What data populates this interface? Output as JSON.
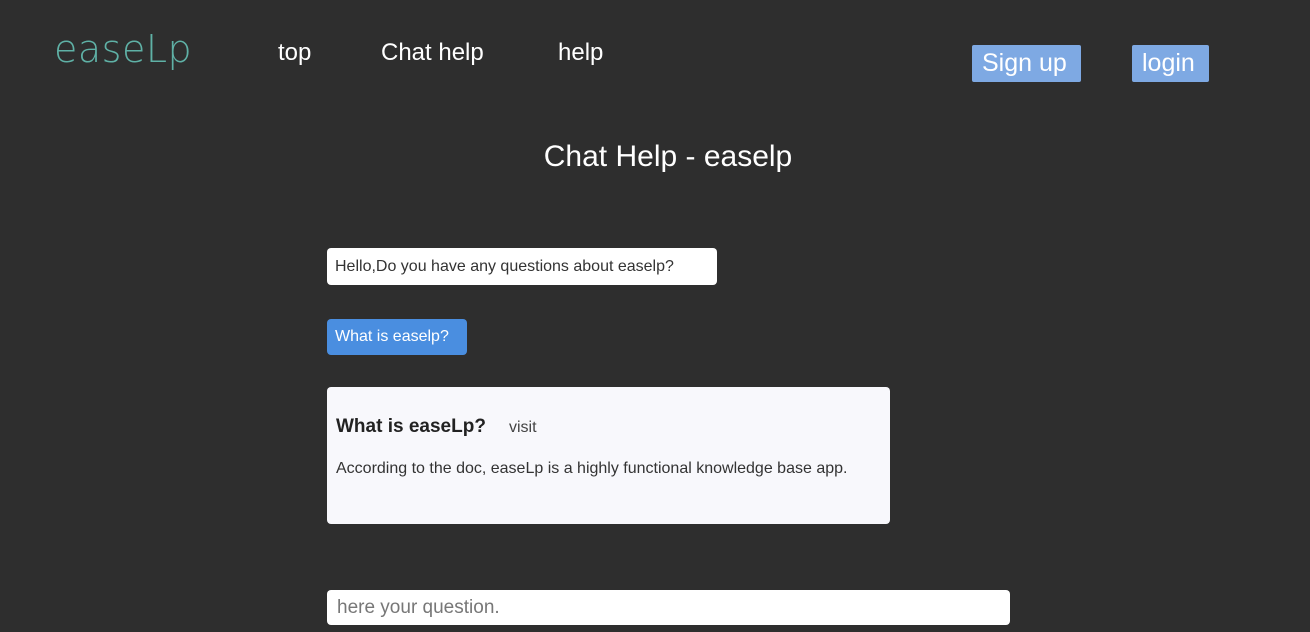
{
  "header": {
    "logo": "easeLp",
    "nav": {
      "top": "top",
      "chat_help": "Chat help",
      "help": "help"
    },
    "signup_label": "Sign up",
    "login_label": "login"
  },
  "page_title": "Chat Help - easelp",
  "chat": {
    "bot_greeting": "Hello,Do you have any questions about easelp?",
    "user_question": "What is easelp?",
    "answer": {
      "heading": "What is easeLp?",
      "visit_label": "visit",
      "body": "According to the doc, easeLp is a highly functional knowledge base app."
    }
  },
  "input": {
    "placeholder": "here your question.",
    "value": ""
  },
  "colors": {
    "background": "#2e2e2e",
    "logo": "#5fb1a6",
    "auth_button": "#7ea9e3",
    "user_bubble": "#4a8ee0",
    "answer_card": "#f8f8fc"
  }
}
